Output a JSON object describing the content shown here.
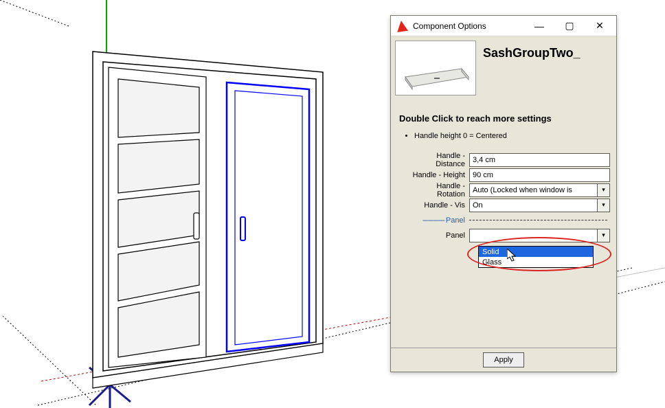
{
  "dialog": {
    "title": "Component Options",
    "min": "—",
    "max": "▢",
    "close": "✕",
    "component_name": "SashGroupTwo_",
    "subtitle": "Double Click to reach more settings",
    "note1": "Handle height 0 = Centered",
    "params": {
      "handle_distance": {
        "label": "Handle - Distance",
        "value": "3,4 cm"
      },
      "handle_height": {
        "label": "Handle - Height",
        "value": "90 cm"
      },
      "handle_rotation": {
        "label": "Handle - Rotation",
        "value": "Auto (Locked when window is"
      },
      "handle_vis": {
        "label": "Handle - Vis",
        "value": "On"
      },
      "section": {
        "label": "Panel"
      },
      "panel": {
        "label": "Panel"
      }
    },
    "dropdown": {
      "opt_solid": "Solid",
      "opt_glass": "Glass"
    },
    "apply": "Apply"
  }
}
